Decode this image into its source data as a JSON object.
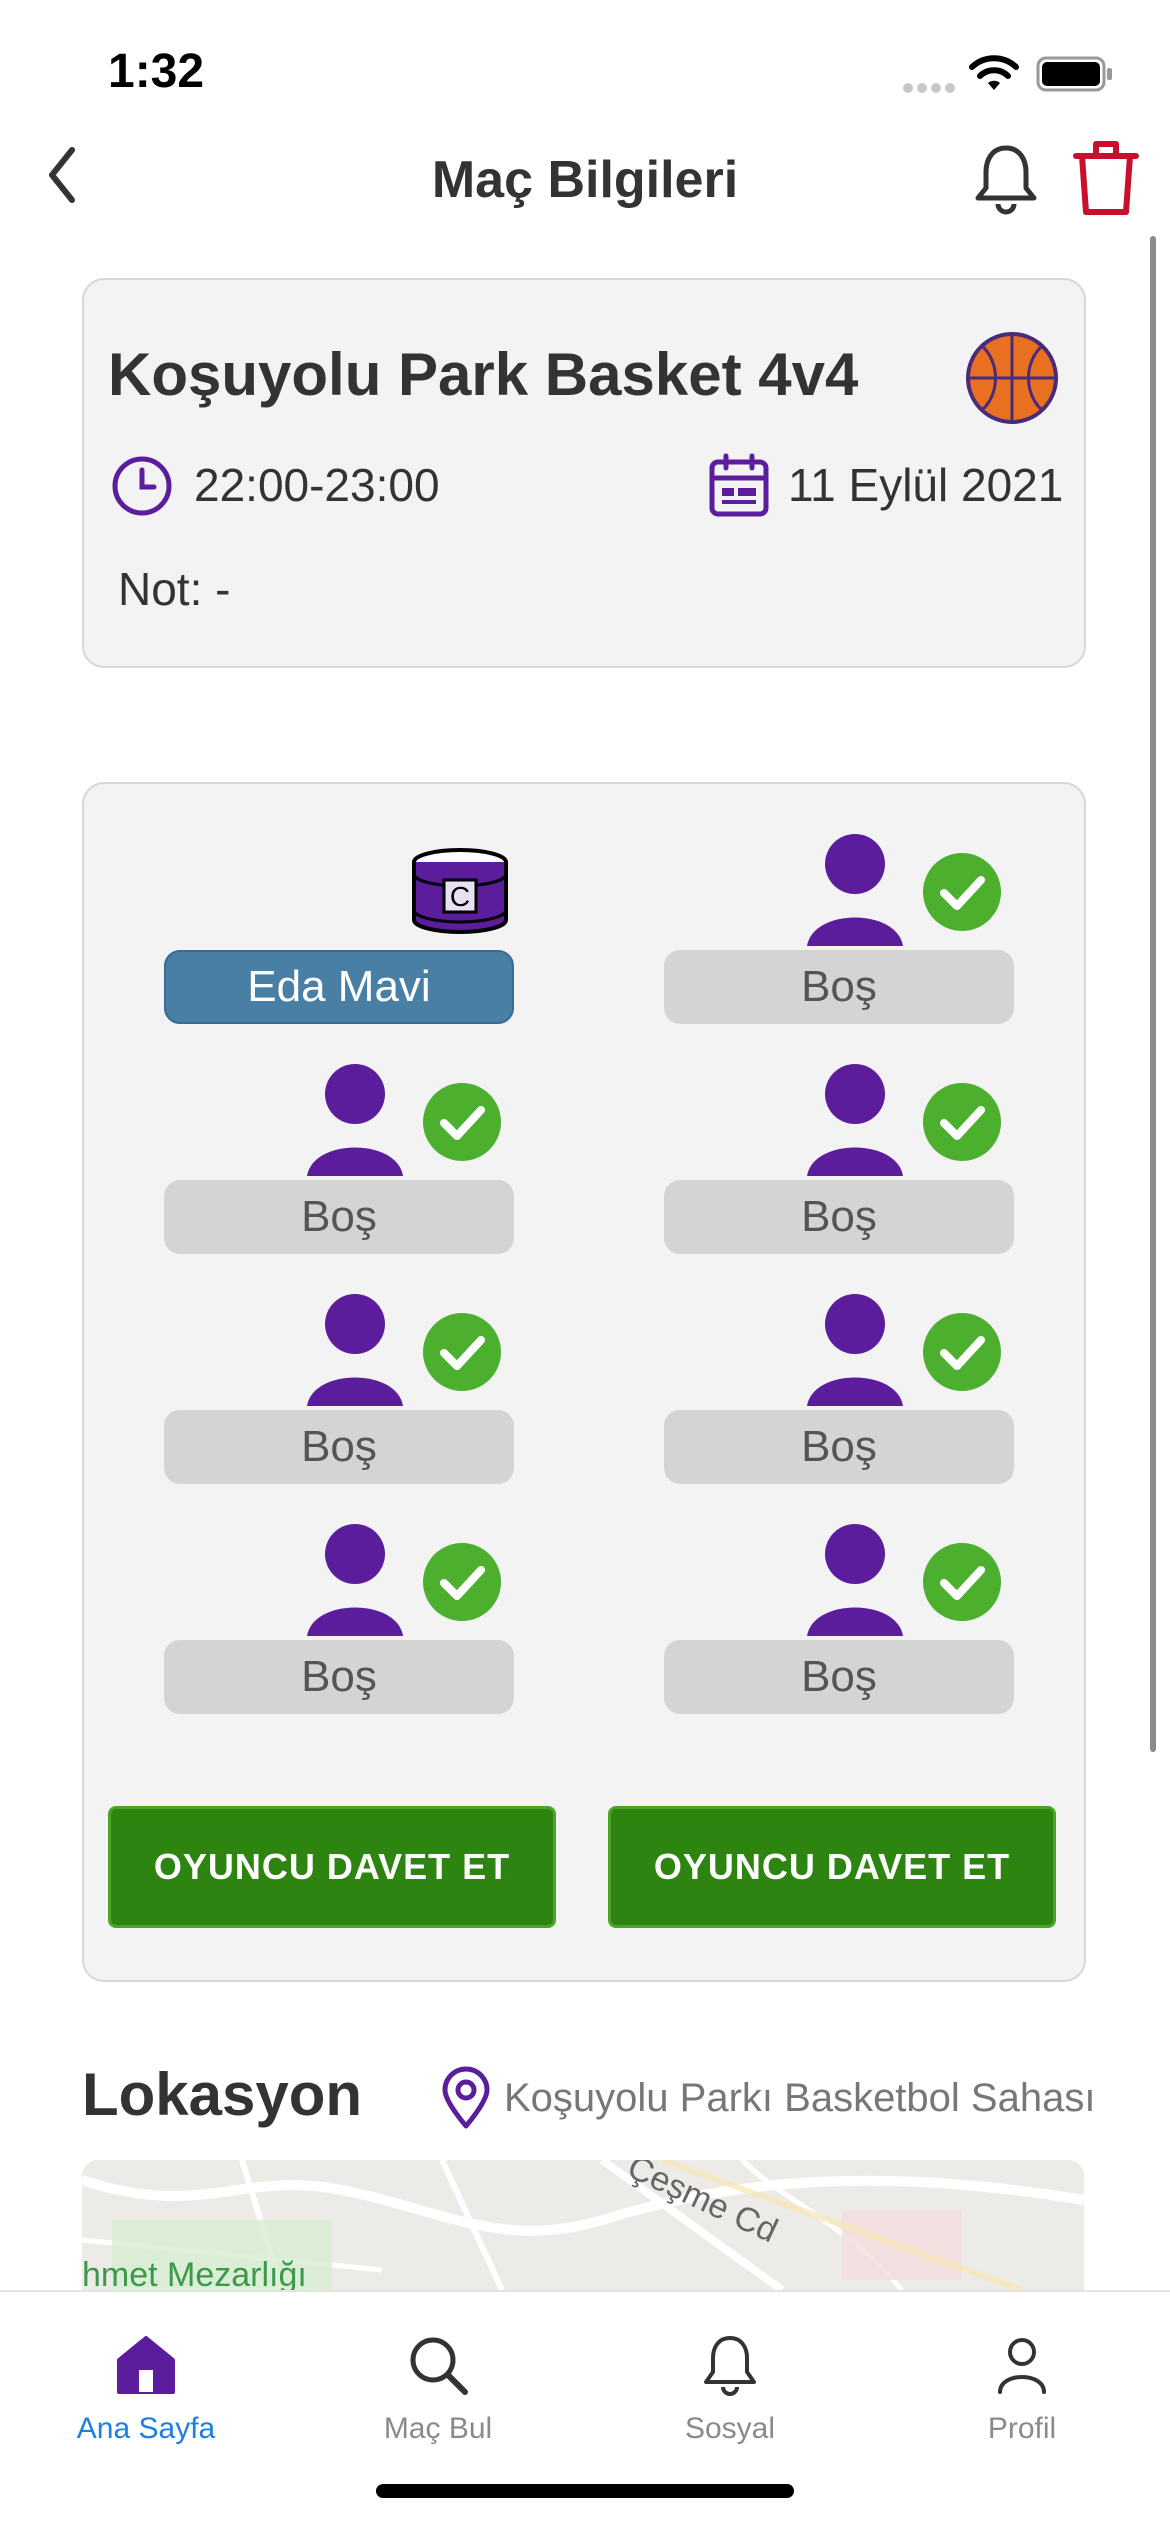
{
  "status_bar": {
    "time": "1:32"
  },
  "header": {
    "title": "Maç Bilgileri"
  },
  "match": {
    "title": "Koşuyolu Park Basket 4v4",
    "time": "22:00-23:00",
    "date": "11 Eylül 2021",
    "note": "Not: -"
  },
  "team": {
    "left": [
      {
        "label": "Eda Mavi",
        "filled": true,
        "captain": true
      },
      {
        "label": "Boş",
        "filled": false
      },
      {
        "label": "Boş",
        "filled": false
      },
      {
        "label": "Boş",
        "filled": false
      }
    ],
    "right": [
      {
        "label": "Boş",
        "filled": false
      },
      {
        "label": "Boş",
        "filled": false
      },
      {
        "label": "Boş",
        "filled": false
      },
      {
        "label": "Boş",
        "filled": false
      }
    ],
    "captain_letter": "C",
    "invite_left": "OYUNCU DAVET ET",
    "invite_right": "OYUNCU DAVET ET"
  },
  "location": {
    "title": "Lokasyon",
    "place": "Koşuyolu Parkı Basketbol Sahası",
    "map_label_1": "hmet Mezarlığı",
    "map_label_2": "Çeşme Cd"
  },
  "tabbar": {
    "items": [
      {
        "label": "Ana Sayfa",
        "icon": "home-icon",
        "active": true
      },
      {
        "label": "Maç Bul",
        "icon": "search-icon",
        "active": false
      },
      {
        "label": "Sosyal",
        "icon": "bell-icon",
        "active": false
      },
      {
        "label": "Profil",
        "icon": "profile-icon",
        "active": false
      }
    ]
  },
  "colors": {
    "accent_purple": "#5b1d9c",
    "check_green": "#4cb02e",
    "button_green": "#2e8410",
    "filled_pill": "#4a7fa5",
    "trash_red": "#c8102e",
    "tab_active": "#1e7fe0"
  }
}
